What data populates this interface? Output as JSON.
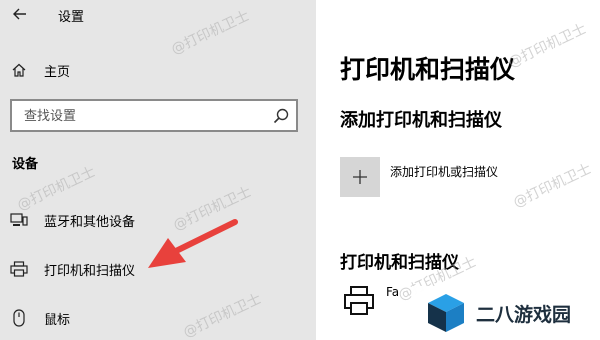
{
  "window": {
    "title": "设置"
  },
  "sidebar": {
    "home_label": "主页",
    "search": {
      "placeholder": "查找设置"
    },
    "section_title": "设备",
    "items": [
      {
        "label": "蓝牙和其他设备",
        "icon": "bluetooth-devices-icon"
      },
      {
        "label": "打印机和扫描仪",
        "icon": "printer-icon"
      },
      {
        "label": "鼠标",
        "icon": "mouse-icon"
      }
    ]
  },
  "main": {
    "page_title": "打印机和扫描仪",
    "add_section_title": "添加打印机和扫描仪",
    "add_button_label": "添加打印机或扫描仪",
    "list_section_title": "打印机和扫描仪",
    "printers": [
      {
        "name": "Fa"
      }
    ]
  },
  "watermark_text": "@打印机卫士",
  "brand": {
    "text": "二八游戏园"
  },
  "colors": {
    "sidebar_bg": "#e6e6e6",
    "add_button_bg": "#d6d6d6",
    "arrow": "#e8413c",
    "logo_blue": "#1e8fd8",
    "logo_dark": "#1e2f3e"
  }
}
